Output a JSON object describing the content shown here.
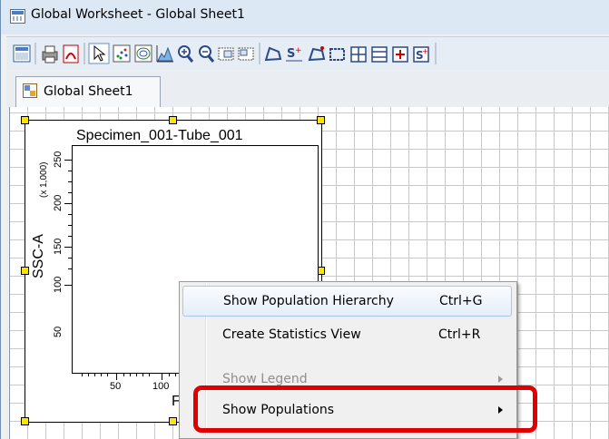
{
  "window": {
    "title": "Global Worksheet - Global Sheet1",
    "icon": "worksheet-icon"
  },
  "toolbar": {
    "buttons": [
      "worksheet-icon",
      "print-icon",
      "pdf-icon",
      "pointer-icon",
      "dot-plot-icon",
      "contour-plot-icon",
      "histogram-icon",
      "zoom-in-icon",
      "zoom-out-icon",
      "snap-grid-icon",
      "snap-grid-2-icon",
      "polygon-gate-icon",
      "snap-to-gate-icon",
      "interval-gate-icon",
      "rectangle-gate-icon",
      "quad-gate-icon",
      "bisector-gate-icon",
      "range-gate-icon",
      "stats-gate-icon"
    ]
  },
  "tabs": [
    {
      "label": "Global Sheet1",
      "icon": "sheet-icon",
      "active": true
    }
  ],
  "plot": {
    "title": "Specimen_001-Tube_001",
    "y_label": "SSC-A",
    "y_scale": "(x 1,000)",
    "y_ticks": [
      "250",
      "200",
      "150",
      "100",
      "50"
    ],
    "x_ticks": [
      "50",
      "100"
    ],
    "x_label": "F"
  },
  "context_menu": {
    "items": [
      {
        "label": "Show Population Hierarchy",
        "shortcut": "Ctrl+G",
        "enabled": true,
        "submenu": false,
        "hovered": true
      },
      {
        "label": "Create Statistics View",
        "shortcut": "Ctrl+R",
        "enabled": true,
        "submenu": false,
        "hovered": false
      },
      {
        "label": "Show Legend",
        "shortcut": "",
        "enabled": false,
        "submenu": true,
        "hovered": false
      },
      {
        "label": "Show Populations",
        "shortcut": "",
        "enabled": true,
        "submenu": true,
        "hovered": false
      }
    ]
  },
  "colors": {
    "highlight": "#e00000",
    "handle": "#ffe400",
    "titlebar": "#dde8f5",
    "menu_hover_border": "#a8c7ea"
  }
}
